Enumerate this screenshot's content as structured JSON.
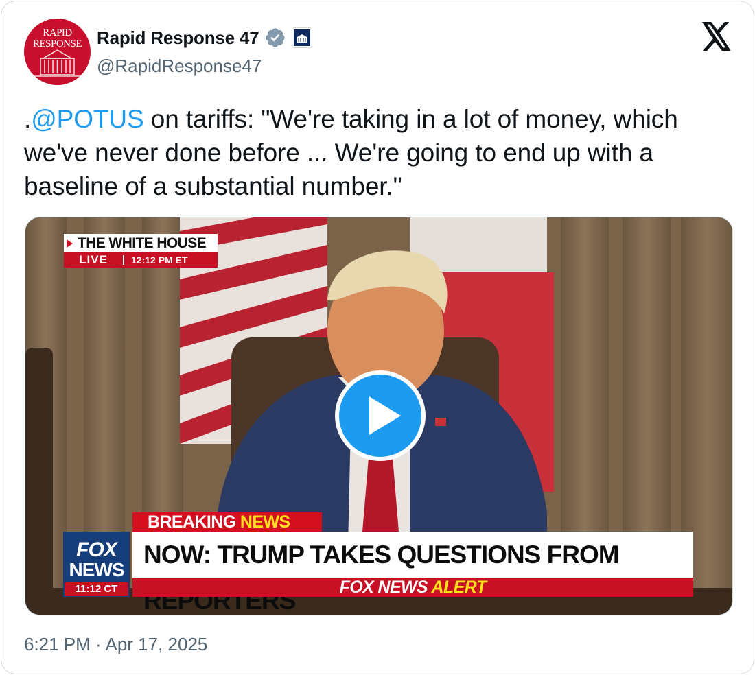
{
  "author": {
    "display_name": "Rapid Response 47",
    "handle": "@RapidResponse47",
    "avatar_text_line1": "RAPID",
    "avatar_text_line2": "RESPONSE",
    "avatar_icon": "white-house-icon",
    "verified_icon": "verified-badge-icon",
    "affiliate_icon": "white-house-badge-icon"
  },
  "platform_icon": "x-logo-icon",
  "tweet": {
    "prefix": ".",
    "mention": "@POTUS",
    "text": " on tariffs: \"We're taking in a lot of money, which we've never done before ... We're going to end up with a baseline of a substantial number.\""
  },
  "video": {
    "location_title": "THE WHITE HOUSE",
    "live_label": "LIVE",
    "live_time": "12:12 PM ET",
    "breaking_label_1": "BREAKING",
    "breaking_label_2": "NEWS",
    "network_logo_1": "FOX",
    "network_logo_2": "NEWS",
    "network_time": "11:12 CT",
    "headline": "NOW: TRUMP TAKES QUESTIONS FROM REPORTERS",
    "alert_brand": "FOX NEWS",
    "alert_word": "ALERT",
    "play_icon": "play-icon"
  },
  "footer": {
    "timestamp": "6:21 PM · Apr 17, 2025"
  },
  "colors": {
    "link": "#1d9bf0",
    "secondary_text": "#536471",
    "border": "#cfd9de",
    "fox_red": "#c81024",
    "fox_blue": "#143d7a",
    "alert_yellow": "#ffe21a"
  }
}
